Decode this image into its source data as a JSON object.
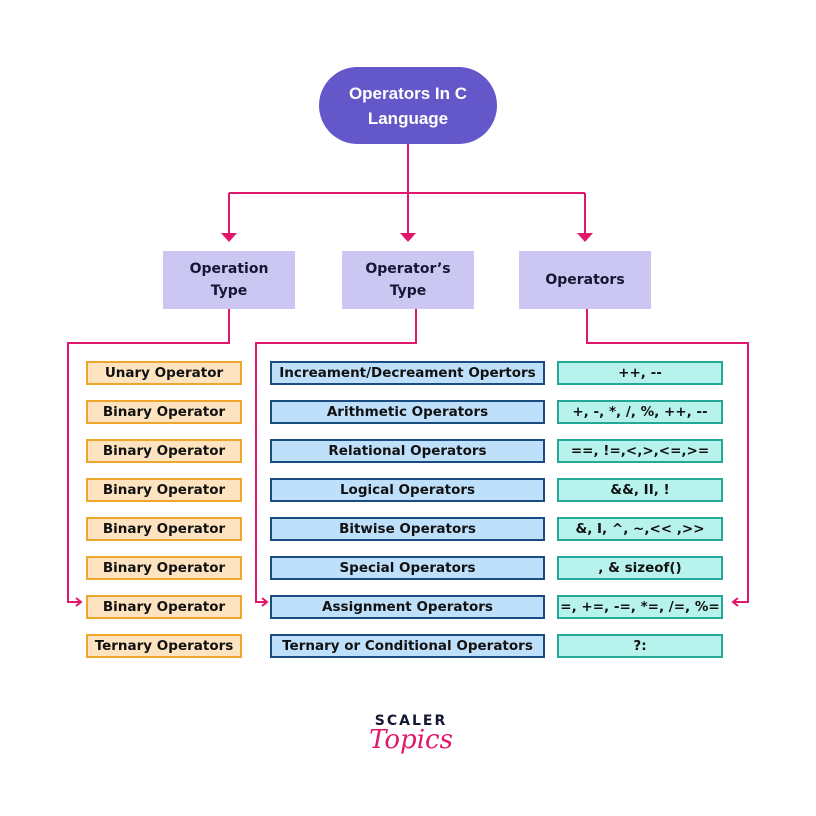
{
  "root": {
    "label": "Operators In C Language"
  },
  "headers": [
    {
      "label": "Operation Type"
    },
    {
      "label": "Operator’s Type"
    },
    {
      "label": "Operators"
    }
  ],
  "rows": [
    {
      "operation_type": "Unary Operator",
      "operator_type": "Increament/Decreament Opertors",
      "operators": "++, --"
    },
    {
      "operation_type": "Binary Operator",
      "operator_type": "Arithmetic Operators",
      "operators": "+, -, *, /, %, ++, --"
    },
    {
      "operation_type": "Binary Operator",
      "operator_type": "Relational Operators",
      "operators": "==, !=,<,>,<=,>="
    },
    {
      "operation_type": "Binary Operator",
      "operator_type": "Logical Operators",
      "operators": "&&, II, !"
    },
    {
      "operation_type": "Binary Operator",
      "operator_type": "Bitwise Operators",
      "operators": "&, I, ^, ~,<< ,>>"
    },
    {
      "operation_type": "Binary Operator",
      "operator_type": "Special Operators",
      "operators": ", & sizeof()"
    },
    {
      "operation_type": "Binary Operator",
      "operator_type": "Assignment Operators",
      "operators": "=, +=, -=, *=, /=, %="
    },
    {
      "operation_type": "Ternary Operators",
      "operator_type": "Ternary or Conditional Operators",
      "operators": "?:"
    }
  ],
  "logo": {
    "top": "SCALER",
    "bottom": "Topics"
  },
  "colors": {
    "root_fill": "#6457c9",
    "header_fill": "#ccc6f2",
    "connector": "#e0186d",
    "type_fill": "#fde3bf",
    "type_border": "#efa62c",
    "kind_fill": "#bfe0fb",
    "kind_border": "#1a4c80",
    "ops_fill": "#b7f2ec",
    "ops_border": "#26a898"
  }
}
